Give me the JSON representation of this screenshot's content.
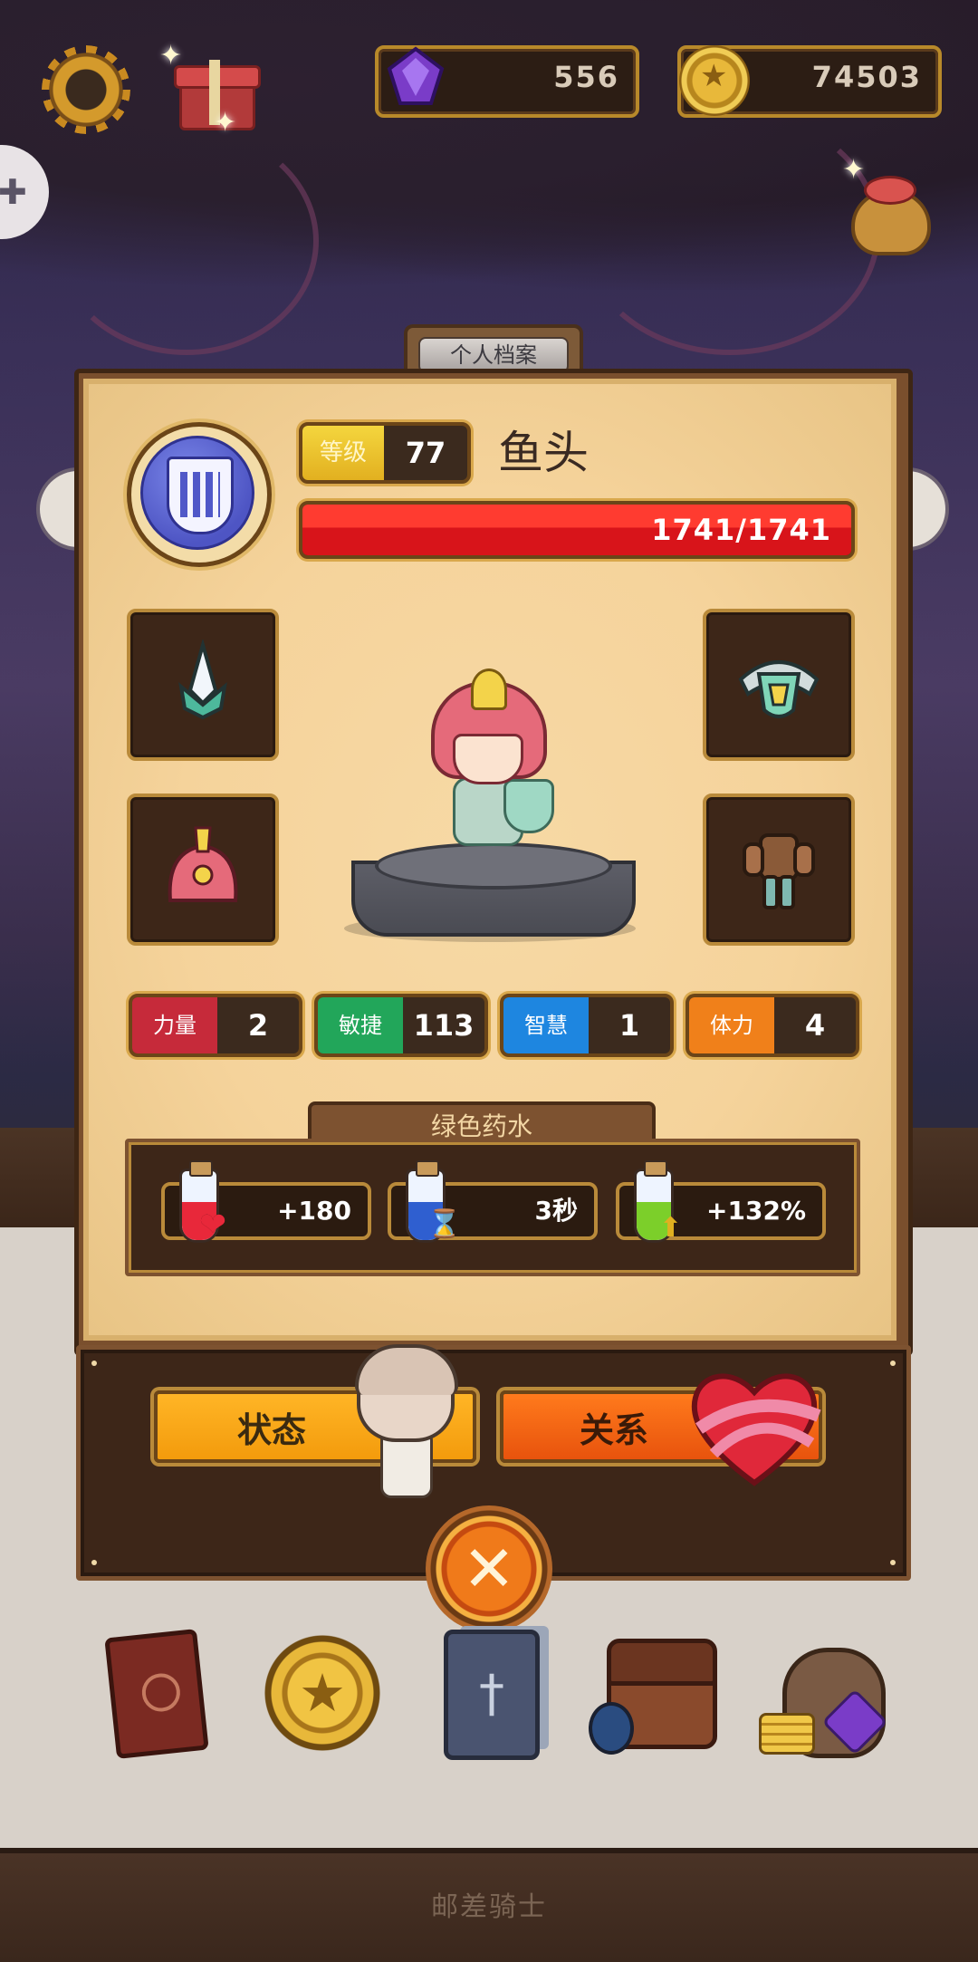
{
  "hud": {
    "gems": "556",
    "coins": "74503"
  },
  "profile": {
    "tab_label": "个人档案",
    "level_label": "等级",
    "level_value": "77",
    "name": "鱼头",
    "hp_text": "1741/1741",
    "hp_fraction": 1.0
  },
  "equipment": [
    {
      "slot": "weapon",
      "icon": "spear-tip-icon"
    },
    {
      "slot": "accessory",
      "icon": "shoulder-guard-icon"
    },
    {
      "slot": "helmet",
      "icon": "red-helmet-icon"
    },
    {
      "slot": "armor",
      "icon": "leather-armor-icon"
    }
  ],
  "stats": [
    {
      "label": "力量",
      "value": "2",
      "color": "#c62a3a"
    },
    {
      "label": "敏捷",
      "value": "113",
      "color": "#22a65a"
    },
    {
      "label": "智慧",
      "value": "1",
      "color": "#1e86e0"
    },
    {
      "label": "体力",
      "value": "4",
      "color": "#f0801a"
    }
  ],
  "potion": {
    "title": "绿色药水",
    "effects": [
      {
        "value": "+180",
        "liquid": "#e8283a",
        "icon": "heart-plus-icon"
      },
      {
        "value": "3秒",
        "liquid": "#2f5fd0",
        "icon": "hourglass-icon"
      },
      {
        "value": "+132%",
        "liquid": "#7ccf2a",
        "icon": "up-arrow-icon"
      }
    ]
  },
  "actions": {
    "status": "状态",
    "relation": "关系"
  },
  "menu": [
    {
      "name": "journal",
      "icon": "book-icon"
    },
    {
      "name": "medal",
      "icon": "star-coin-icon"
    },
    {
      "name": "cards",
      "icon": "card-deck-icon"
    },
    {
      "name": "inventory",
      "icon": "backpack-icon"
    },
    {
      "name": "shop",
      "icon": "treasure-sack-icon"
    }
  ],
  "footer": "邮差骑士"
}
